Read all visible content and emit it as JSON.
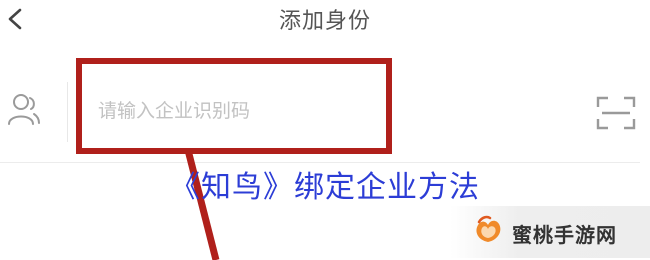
{
  "header": {
    "title": "添加身份",
    "back_icon": "chevron-left-icon"
  },
  "form": {
    "user_icon": "person-icon",
    "code_placeholder": "请输入企业识别码",
    "code_value": "",
    "scan_icon": "scan-icon"
  },
  "annotation": {
    "caption": "《知鸟》绑定企业方法",
    "highlight_color": "#b0201b",
    "caption_color": "#2c3dd6"
  },
  "watermark": {
    "site_name": "蜜桃手游网"
  }
}
